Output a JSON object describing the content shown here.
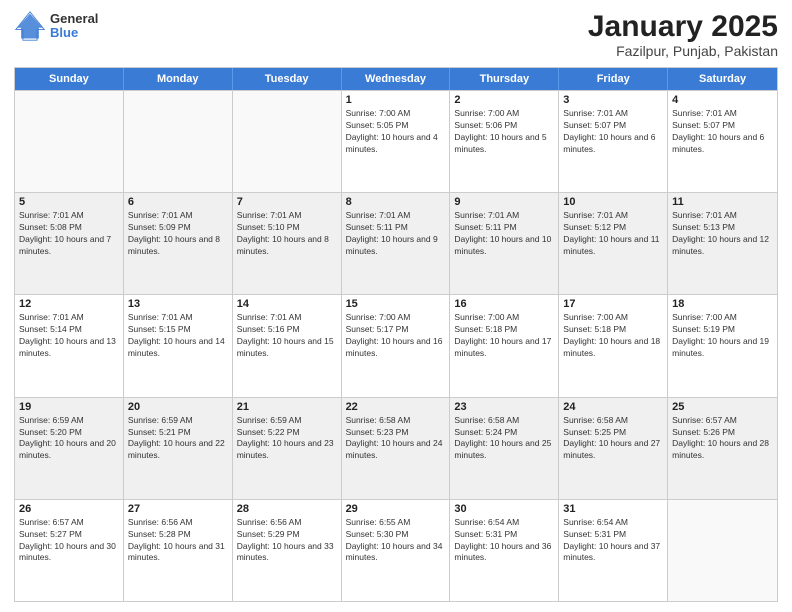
{
  "logo": {
    "general": "General",
    "blue": "Blue"
  },
  "title": "January 2025",
  "subtitle": "Fazilpur, Punjab, Pakistan",
  "days_of_week": [
    "Sunday",
    "Monday",
    "Tuesday",
    "Wednesday",
    "Thursday",
    "Friday",
    "Saturday"
  ],
  "weeks": [
    [
      {
        "day": "",
        "empty": true
      },
      {
        "day": "",
        "empty": true
      },
      {
        "day": "",
        "empty": true
      },
      {
        "day": "1",
        "sunrise": "7:00 AM",
        "sunset": "5:05 PM",
        "daylight": "10 hours and 4 minutes."
      },
      {
        "day": "2",
        "sunrise": "7:00 AM",
        "sunset": "5:06 PM",
        "daylight": "10 hours and 5 minutes."
      },
      {
        "day": "3",
        "sunrise": "7:01 AM",
        "sunset": "5:07 PM",
        "daylight": "10 hours and 6 minutes."
      },
      {
        "day": "4",
        "sunrise": "7:01 AM",
        "sunset": "5:07 PM",
        "daylight": "10 hours and 6 minutes."
      }
    ],
    [
      {
        "day": "5",
        "sunrise": "7:01 AM",
        "sunset": "5:08 PM",
        "daylight": "10 hours and 7 minutes."
      },
      {
        "day": "6",
        "sunrise": "7:01 AM",
        "sunset": "5:09 PM",
        "daylight": "10 hours and 8 minutes."
      },
      {
        "day": "7",
        "sunrise": "7:01 AM",
        "sunset": "5:10 PM",
        "daylight": "10 hours and 8 minutes."
      },
      {
        "day": "8",
        "sunrise": "7:01 AM",
        "sunset": "5:11 PM",
        "daylight": "10 hours and 9 minutes."
      },
      {
        "day": "9",
        "sunrise": "7:01 AM",
        "sunset": "5:11 PM",
        "daylight": "10 hours and 10 minutes."
      },
      {
        "day": "10",
        "sunrise": "7:01 AM",
        "sunset": "5:12 PM",
        "daylight": "10 hours and 11 minutes."
      },
      {
        "day": "11",
        "sunrise": "7:01 AM",
        "sunset": "5:13 PM",
        "daylight": "10 hours and 12 minutes."
      }
    ],
    [
      {
        "day": "12",
        "sunrise": "7:01 AM",
        "sunset": "5:14 PM",
        "daylight": "10 hours and 13 minutes."
      },
      {
        "day": "13",
        "sunrise": "7:01 AM",
        "sunset": "5:15 PM",
        "daylight": "10 hours and 14 minutes."
      },
      {
        "day": "14",
        "sunrise": "7:01 AM",
        "sunset": "5:16 PM",
        "daylight": "10 hours and 15 minutes."
      },
      {
        "day": "15",
        "sunrise": "7:00 AM",
        "sunset": "5:17 PM",
        "daylight": "10 hours and 16 minutes."
      },
      {
        "day": "16",
        "sunrise": "7:00 AM",
        "sunset": "5:18 PM",
        "daylight": "10 hours and 17 minutes."
      },
      {
        "day": "17",
        "sunrise": "7:00 AM",
        "sunset": "5:18 PM",
        "daylight": "10 hours and 18 minutes."
      },
      {
        "day": "18",
        "sunrise": "7:00 AM",
        "sunset": "5:19 PM",
        "daylight": "10 hours and 19 minutes."
      }
    ],
    [
      {
        "day": "19",
        "sunrise": "6:59 AM",
        "sunset": "5:20 PM",
        "daylight": "10 hours and 20 minutes."
      },
      {
        "day": "20",
        "sunrise": "6:59 AM",
        "sunset": "5:21 PM",
        "daylight": "10 hours and 22 minutes."
      },
      {
        "day": "21",
        "sunrise": "6:59 AM",
        "sunset": "5:22 PM",
        "daylight": "10 hours and 23 minutes."
      },
      {
        "day": "22",
        "sunrise": "6:58 AM",
        "sunset": "5:23 PM",
        "daylight": "10 hours and 24 minutes."
      },
      {
        "day": "23",
        "sunrise": "6:58 AM",
        "sunset": "5:24 PM",
        "daylight": "10 hours and 25 minutes."
      },
      {
        "day": "24",
        "sunrise": "6:58 AM",
        "sunset": "5:25 PM",
        "daylight": "10 hours and 27 minutes."
      },
      {
        "day": "25",
        "sunrise": "6:57 AM",
        "sunset": "5:26 PM",
        "daylight": "10 hours and 28 minutes."
      }
    ],
    [
      {
        "day": "26",
        "sunrise": "6:57 AM",
        "sunset": "5:27 PM",
        "daylight": "10 hours and 30 minutes."
      },
      {
        "day": "27",
        "sunrise": "6:56 AM",
        "sunset": "5:28 PM",
        "daylight": "10 hours and 31 minutes."
      },
      {
        "day": "28",
        "sunrise": "6:56 AM",
        "sunset": "5:29 PM",
        "daylight": "10 hours and 33 minutes."
      },
      {
        "day": "29",
        "sunrise": "6:55 AM",
        "sunset": "5:30 PM",
        "daylight": "10 hours and 34 minutes."
      },
      {
        "day": "30",
        "sunrise": "6:54 AM",
        "sunset": "5:31 PM",
        "daylight": "10 hours and 36 minutes."
      },
      {
        "day": "31",
        "sunrise": "6:54 AM",
        "sunset": "5:31 PM",
        "daylight": "10 hours and 37 minutes."
      },
      {
        "day": "",
        "empty": true
      }
    ]
  ]
}
